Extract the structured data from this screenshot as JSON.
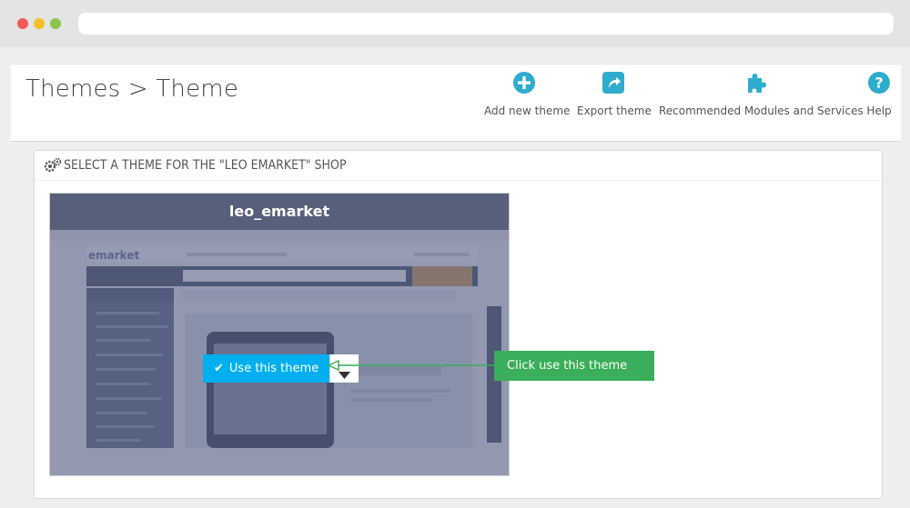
{
  "page": {
    "title": "Themes > Theme"
  },
  "toolbar": {
    "buttons": [
      {
        "label": "Add new theme",
        "icon": "plus-circle-icon"
      },
      {
        "label": "Export theme",
        "icon": "share-icon"
      },
      {
        "label": "Recommended Modules and Services",
        "icon": "puzzle-icon"
      },
      {
        "label": "Help",
        "icon": "question-circle-icon"
      }
    ]
  },
  "panel": {
    "title": "SELECT A THEME FOR THE \"LEO EMARKET\" SHOP",
    "icon": "gears-icon"
  },
  "theme_card": {
    "name": "leo_emarket",
    "use_button_label": "Use this theme",
    "dropdown_icon": "caret-down-icon"
  },
  "callout": {
    "text": "Click use this theme"
  },
  "colors": {
    "accent_blue": "#2eacce",
    "card_header": "#56607a",
    "use_button": "#00aff0",
    "callout_green": "#3aae5a"
  }
}
